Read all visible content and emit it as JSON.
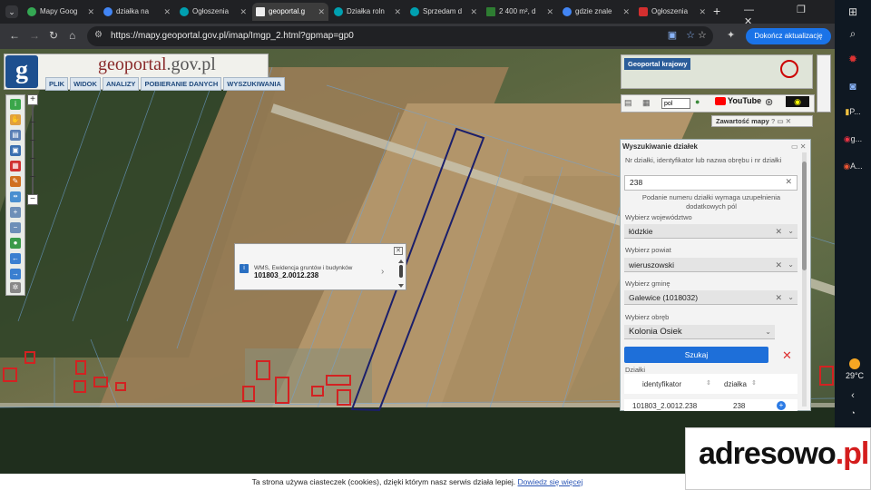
{
  "browser": {
    "tabs": [
      {
        "label": "Mapy Goog",
        "color": "#34a853"
      },
      {
        "label": "działka na",
        "color": "#4285f4"
      },
      {
        "label": "Ogłoszenia",
        "color": "#00a0b0"
      },
      {
        "label": "geoportal.g",
        "color": "#eeeeee"
      },
      {
        "label": "Działka roln",
        "color": "#00a0b0"
      },
      {
        "label": "Sprzedam d",
        "color": "#00a0b0"
      },
      {
        "label": "2 400 m², d",
        "color": "#2e7d32"
      },
      {
        "label": "gdzie znale",
        "color": "#4285f4"
      },
      {
        "label": "Ogłoszenia",
        "color": "#d32f2f"
      }
    ],
    "new_tab": "+",
    "window_controls": "— ❐ ✕",
    "url": "https://mapy.geoportal.gov.pl/imap/Imgp_2.html?gpmap=gp0",
    "update_button": "Dokończ aktualizację"
  },
  "geoportal": {
    "title_main": "geoportal",
    "title_suffix": ".gov.pl",
    "logo_letter": "g",
    "menu": [
      "PLIK",
      "WIDOK",
      "ANALIZY",
      "POBIERANIE DANYCH",
      "WYSZUKIWANIA"
    ],
    "overview_label": "Geoportal krajowy",
    "language": "pol",
    "youtube_label": "YouTube",
    "map_content_label": "Zawartość mapy",
    "map_content_icons": "? ▭ ✕"
  },
  "search_panel": {
    "title": "Wyszukiwanie działek",
    "title_icons": "▭ ✕",
    "parcel_label": "Nr działki, identyfikator lub nazwa obrębu i nr działki",
    "parcel_value": "238",
    "parcel_clear": "✕",
    "parcel_note": "Podanie numeru działki wymaga uzupełnienia dodatkowych pól",
    "voivodeship_label": "Wybierz województwo",
    "voivodeship_value": "łódzkie",
    "county_label": "Wybierz powiat",
    "county_value": "wieruszowski",
    "commune_label": "Wybierz gminę",
    "commune_value": "Galewice (1018032)",
    "precinct_label": "Wybierz obręb",
    "precinct_value": "Kolonia Osiek",
    "search_button": "Szukaj",
    "reset_icon": "✕",
    "results_label": "Działki",
    "columns": [
      "identyfikator",
      "działka"
    ],
    "row": {
      "identifier": "101803_2.0012.238",
      "parcel": "238"
    }
  },
  "popup": {
    "layer": "WMS, Ewidencja gruntów i budynków",
    "identifier": "101803_2.0012.238",
    "info_icon": "i",
    "next_icon": "›",
    "close_icon": "✕"
  },
  "footer": {
    "cookie_text": "Ta strona używa ciasteczek (cookies), dzięki którym nasz serwis działa lepiej.",
    "cookie_link": "Dowiedz się więcej",
    "watermark_text": "adresowo",
    "watermark_suffix": ".pl"
  },
  "taskbar": {
    "temperature": "29°C",
    "items": [
      "P...",
      "g...",
      "A..."
    ]
  },
  "colors": {
    "accent_blue": "#1e6fd9",
    "parcel_outline": "#1b1f6b",
    "building_red": "#d32222"
  }
}
